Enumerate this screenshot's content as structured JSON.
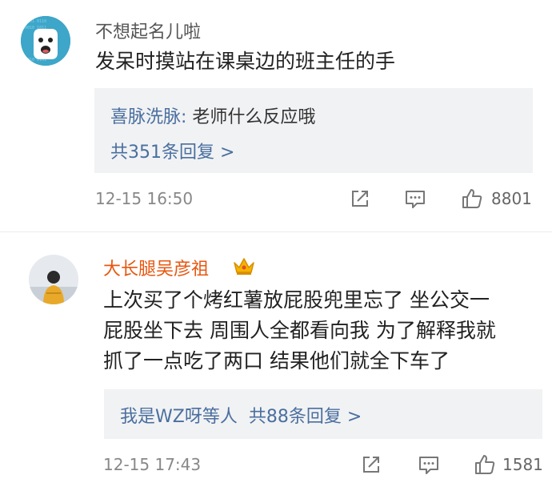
{
  "comments": [
    {
      "username": "不想起名儿啦",
      "lines": [
        "发呆时摸站在课桌边的班主任的手"
      ],
      "reply": {
        "name": "喜脉洗脉:",
        "text": " 老师什么反应哦",
        "count": "共351条回复 >"
      },
      "time": "12-15 16:50",
      "likes": "8801",
      "icons": {
        "share": "share-icon",
        "comment": "comment-icon",
        "like": "thumbs-up-icon"
      }
    },
    {
      "username": "大长腿吴彦祖",
      "badge": "crown-icon",
      "lines": [
        "上次买了个烤红薯放屁股兜里忘了 坐公交一",
        "屁股坐下去 周围人全都看向我 为了解释我就",
        "抓了一点吃了两口 结果他们就全下车了"
      ],
      "reply": {
        "name": "我是WZ呀等人",
        "count": "共88条回复 >"
      },
      "time": "12-15 17:43",
      "likes": "1581",
      "icons": {
        "share": "share-icon",
        "comment": "comment-icon",
        "like": "thumbs-up-icon"
      }
    }
  ],
  "colors": {
    "username_gray": "#555555",
    "username_orange": "#e8560f",
    "link_blue": "#4a6f9f",
    "reply_bg": "#f1f2f4",
    "meta_gray": "#888888"
  }
}
